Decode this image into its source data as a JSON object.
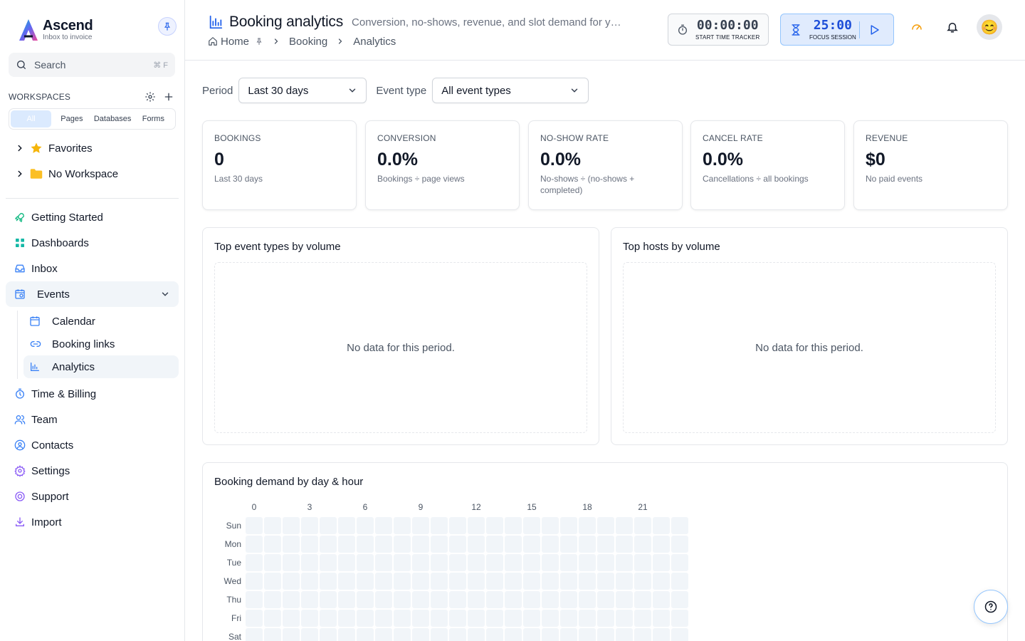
{
  "brand": {
    "name": "Ascend",
    "tagline": "Inbox to invoice"
  },
  "search": {
    "label": "Search",
    "shortcut": "⌘ F"
  },
  "workspaces": {
    "title": "WORKSPACES",
    "tabs": [
      "All",
      "Pages",
      "Databases",
      "Forms"
    ],
    "items": [
      {
        "label": "Favorites",
        "icon": "star-icon"
      },
      {
        "label": "No Workspace",
        "icon": "folder-icon"
      }
    ]
  },
  "nav": {
    "items": [
      {
        "label": "Getting Started",
        "icon": "rocket-icon"
      },
      {
        "label": "Dashboards",
        "icon": "grid-icon"
      },
      {
        "label": "Inbox",
        "icon": "inbox-icon"
      },
      {
        "label": "Events",
        "icon": "calendar-clock-icon"
      },
      {
        "label": "Time & Billing",
        "icon": "stopwatch-icon"
      },
      {
        "label": "Team",
        "icon": "users-icon"
      },
      {
        "label": "Contacts",
        "icon": "contact-icon"
      },
      {
        "label": "Settings",
        "icon": "gear-icon"
      },
      {
        "label": "Support",
        "icon": "lifebuoy-icon"
      },
      {
        "label": "Import",
        "icon": "download-icon"
      }
    ],
    "events_sub": [
      {
        "label": "Calendar",
        "icon": "calendar-icon"
      },
      {
        "label": "Booking links",
        "icon": "link-icon"
      },
      {
        "label": "Analytics",
        "icon": "bar-chart-icon"
      }
    ]
  },
  "header": {
    "title": "Booking analytics",
    "subtitle": "Conversion, no-shows, revenue, and slot demand for your…",
    "breadcrumb": [
      "Home",
      "Booking",
      "Analytics"
    ],
    "time_tracker": {
      "time": "00:00:00",
      "label": "START TIME TRACKER"
    },
    "focus_session": {
      "time": "25:00",
      "label": "FOCUS SESSION"
    },
    "avatar_emoji": "😊"
  },
  "filters": {
    "period_label": "Period",
    "period_value": "Last 30 days",
    "event_type_label": "Event type",
    "event_type_value": "All event types"
  },
  "kpis": [
    {
      "title": "BOOKINGS",
      "value": "0",
      "sub": "Last 30 days"
    },
    {
      "title": "CONVERSION",
      "value": "0.0%",
      "sub": "Bookings ÷ page views"
    },
    {
      "title": "NO-SHOW RATE",
      "value": "0.0%",
      "sub": "No-shows ÷ (no-shows + completed)"
    },
    {
      "title": "CANCEL RATE",
      "value": "0.0%",
      "sub": "Cancellations ÷ all bookings"
    },
    {
      "title": "REVENUE",
      "value": "$0",
      "sub": "No paid events"
    }
  ],
  "panels": {
    "top_event_types": {
      "title": "Top event types by volume",
      "empty": "No data for this period."
    },
    "top_hosts": {
      "title": "Top hosts by volume",
      "empty": "No data for this period."
    }
  },
  "heatmap": {
    "title": "Booking demand by day & hour",
    "hour_labels": [
      "0",
      "3",
      "6",
      "9",
      "12",
      "15",
      "18",
      "21"
    ],
    "days": [
      "Sun",
      "Mon",
      "Tue",
      "Wed",
      "Thu",
      "Fri",
      "Sat"
    ],
    "hours": 24,
    "values_note_free": true
  },
  "colors": {
    "accent": "#2563eb",
    "heat_empty": "#f1f5f9"
  }
}
